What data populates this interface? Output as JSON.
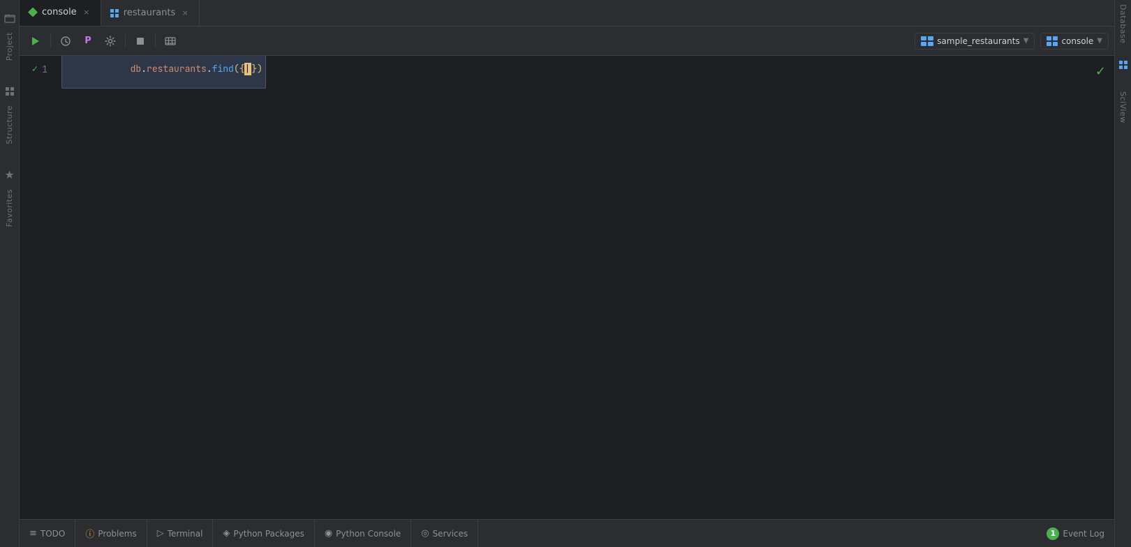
{
  "tabs": [
    {
      "id": "console",
      "label": "console",
      "icon": "mongo",
      "active": true
    },
    {
      "id": "restaurants",
      "label": "restaurants",
      "icon": "grid",
      "active": false
    }
  ],
  "toolbar": {
    "run_label": "▶",
    "history_label": "⏱",
    "profile_label": "P",
    "settings_label": "⚙",
    "stop_label": "◼",
    "table_label": "≡",
    "db_selector": "sample_restaurants",
    "connection_selector": "console"
  },
  "editor": {
    "code_line": "db.restaurants.find({})",
    "line_number": "1"
  },
  "bottom_bar": {
    "todo_label": "TODO",
    "problems_label": "Problems",
    "terminal_label": "Terminal",
    "python_packages_label": "Python Packages",
    "python_console_label": "Python Console",
    "services_label": "Services",
    "event_log_label": "Event Log",
    "event_log_count": "1"
  },
  "right_sidebar": {
    "database_label": "Database",
    "sciview_label": "SciView"
  },
  "left_sidebar": {
    "project_label": "Project",
    "structure_label": "Structure",
    "favorites_label": "Favorites"
  }
}
